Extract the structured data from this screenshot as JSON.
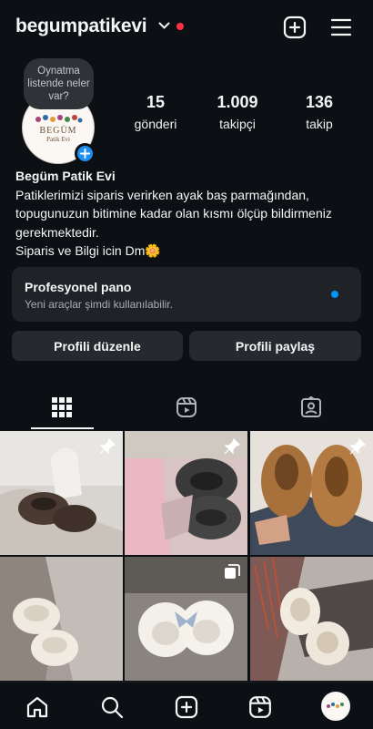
{
  "header": {
    "username": "begumpatikevi",
    "notification_dot_color": "#ff3040",
    "icons": [
      "chevron-down-icon",
      "plus-square-icon",
      "hamburger-menu-icon"
    ]
  },
  "profile": {
    "note_bubble": "Oynatma listende neler var?",
    "avatar_text": "BEGÜM",
    "avatar_subtext": "Patik Evi",
    "stats": [
      {
        "value": "15",
        "label": "gönderi"
      },
      {
        "value": "1.009",
        "label": "takipçi"
      },
      {
        "value": "136",
        "label": "takip"
      }
    ]
  },
  "bio": {
    "name": "Begüm Patik Evi",
    "lines": [
      "Patiklerimizi siparis verirken ayak baş parmağından,",
      "topugunuzun bitimine kadar olan kısmı ölçüp bildirmeniz",
      "gerekmektedir.",
      "Siparis ve Bilgi icin Dm🌼"
    ]
  },
  "professional_panel": {
    "title": "Profesyonel pano",
    "subtitle": "Yeni araçlar şimdi kullanılabilir.",
    "dot_color": "#0095f6"
  },
  "actions": {
    "edit_label": "Profili düzenle",
    "share_label": "Profili paylaş"
  },
  "tabs": [
    "grid-icon",
    "reels-icon",
    "tagged-icon"
  ],
  "posts": [
    {
      "overlay": "pin-icon",
      "theme": "dark-slipper-white-socks"
    },
    {
      "overlay": "pin-icon",
      "theme": "grey-fluffy-slippers-pink-bag"
    },
    {
      "overlay": "pin-icon",
      "theme": "brown-teddy-shoes"
    },
    {
      "overlay": "",
      "theme": "cream-slippers-on-blanket"
    },
    {
      "overlay": "carousel-icon",
      "theme": "white-fluffy-slippers-bow"
    },
    {
      "overlay": "",
      "theme": "cream-fluffy-slippers-chair"
    }
  ],
  "bottom_nav": [
    "home-icon",
    "search-icon",
    "create-icon",
    "reels-icon",
    "profile-avatar"
  ]
}
